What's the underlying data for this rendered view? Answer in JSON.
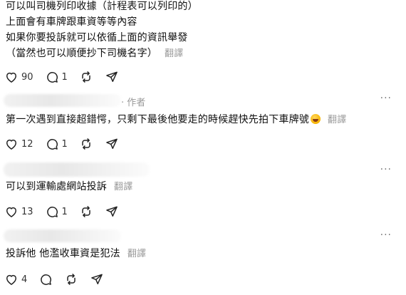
{
  "post": {
    "lines": [
      "可以叫司機列印收據（計程表可以列印的）",
      "上面會有車牌跟車資等等內容",
      "如果你要投訴就可以依循上面的資訊舉發",
      "（當然也可以順便抄下司機名字）"
    ],
    "translate_label": "翻譯",
    "likes": "90",
    "replies": "1"
  },
  "comments": [
    {
      "author_badge": "· 作者",
      "text": "第一次遇到直接超錯愕，只剩下最後他要走的時候趕快先拍下車牌號",
      "emoji": "rolling-on-floor-laughing",
      "translate_label": "翻譯",
      "likes": "12",
      "replies": "1",
      "more": "···"
    },
    {
      "text": "可以到運輸處網站投訴",
      "translate_label": "翻譯",
      "likes": "13",
      "replies": "1",
      "more": "···"
    },
    {
      "text": "投訴他 他濫收車資是犯法",
      "translate_label": "翻譯",
      "likes": "4",
      "more": "···"
    }
  ],
  "icons": {
    "like": "heart-icon",
    "reply": "comment-bubble-icon",
    "repost": "repost-icon",
    "share": "send-icon"
  }
}
